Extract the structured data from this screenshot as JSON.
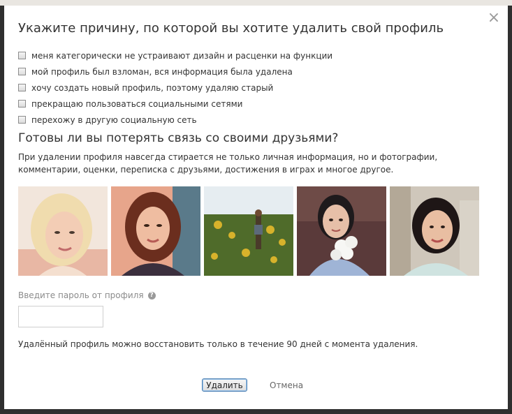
{
  "dialog": {
    "title": "Укажите причину, по которой вы хотите удалить свой профиль",
    "close_label": "×",
    "reasons": [
      "меня категорически не устраивают дизайн и расценки на функции",
      "мой профиль был взломан, вся информация была удалена",
      "хочу создать новый профиль, поэтому удаляю старый",
      "прекращаю пользоваться социальными сетями",
      "перехожу в другую социальную сеть"
    ],
    "subtitle": "Готовы ли вы потерять связь со своими друзьями?",
    "description": "При удалении профиля навсегда стирается не только личная информация, но и фотографии, комментарии, оценки, переписка с друзьями, достижения в играх и многое другое.",
    "friend_photos": [
      "friend-photo-1",
      "friend-photo-2",
      "friend-photo-3",
      "friend-photo-4",
      "friend-photo-5"
    ],
    "password_label": "Введите пароль от профиля",
    "help_icon": "?",
    "password_value": "",
    "restore_note": "Удалённый профиль можно восстановить только в течение 90 дней с момента удаления.",
    "delete_button": "Удалить",
    "cancel_link": "Отмена"
  }
}
